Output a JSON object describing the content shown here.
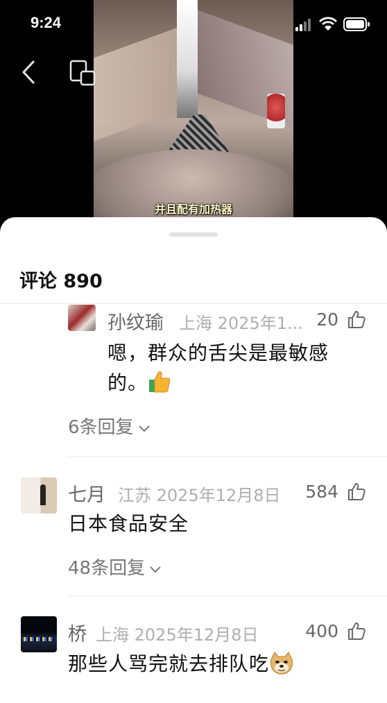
{
  "status": {
    "time": "9:24"
  },
  "video": {
    "caption": "并且配有加热器"
  },
  "sheet": {
    "title": "评论 890"
  },
  "comments": [
    {
      "user": "孙纹瑜",
      "location": "上海",
      "date": "2025年1...",
      "likes": "20",
      "text_line1": "嗯，群众的舌尖是最敏感",
      "text_line2": "的。",
      "emoji": "thumbs-up-emoji",
      "replies": "6条回复"
    },
    {
      "user": "七月",
      "location": "江苏",
      "date": "2025年12月8日",
      "likes": "584",
      "text_line1": "日本食品安全",
      "replies": "48条回复"
    },
    {
      "user": "桥",
      "location": "上海",
      "date": "2025年12月8日",
      "likes": "400",
      "text_line1": "那些人骂完就去排队吃",
      "emoji": "doge-emoji"
    }
  ],
  "icons": {
    "back": "chevron-left-icon",
    "pip": "picture-in-picture-icon",
    "like": "thumbs-up-outline-icon",
    "expand": "chevron-down-icon",
    "signal": "cellular-signal-icon",
    "wifi": "wifi-icon",
    "battery": "battery-icon"
  },
  "colors": {
    "sheet_bg": "#ffffff",
    "secondary_text": "#666666",
    "meta_text": "#aeaeae"
  }
}
